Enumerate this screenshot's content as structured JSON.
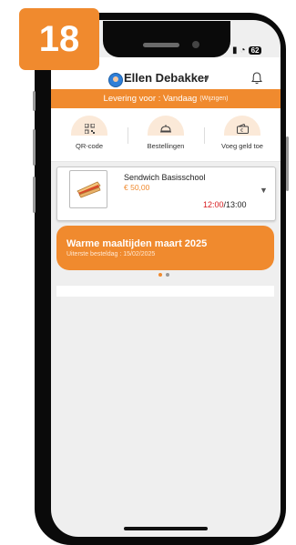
{
  "step": "18",
  "status": {
    "battery": "62"
  },
  "header": {
    "user_name": "Ellen Debakker"
  },
  "delivery": {
    "label": "Levering voor : Vandaag",
    "change": "(Wijzigen)"
  },
  "quick_actions": [
    {
      "label": "QR-code",
      "icon": "qr-code-icon"
    },
    {
      "label": "Bestellingen",
      "icon": "food-tray-icon"
    },
    {
      "label": "Voeg geld toe",
      "icon": "wallet-add-icon"
    }
  ],
  "order": {
    "title": "Sendwich Basisschool",
    "price": "€ 50,00",
    "time_start": "12:00",
    "time_end": "/13:00"
  },
  "banner": {
    "title": "Warme maaltijden maart 2025",
    "subtitle": "Uiterste besteldag : 15/02/2025"
  },
  "colors": {
    "accent": "#f08a2e",
    "time_red": "#d7191c"
  }
}
